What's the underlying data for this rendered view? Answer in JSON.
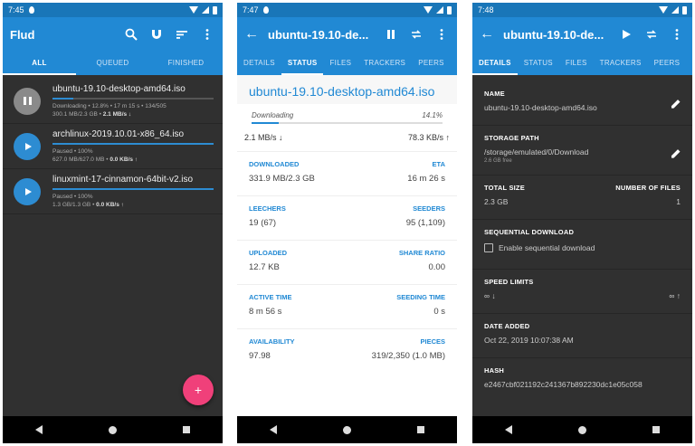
{
  "status_times": [
    "7:45",
    "7:47",
    "7:48"
  ],
  "panel1": {
    "title": "Flud",
    "tabs": [
      "ALL",
      "QUEUED",
      "FINISHED"
    ],
    "torrents": [
      {
        "name": "ubuntu-19.10-desktop-amd64.iso",
        "meta1": "Downloading • 12.8% • 17 m 15 s • 134/505",
        "meta2a": "300.1 MB/2.3 GB • ",
        "meta2b": "2.1 MB/s ↓",
        "progress": 0.128,
        "state": "pause"
      },
      {
        "name": "archlinux-2019.10.01-x86_64.iso",
        "meta1": "Paused • 100%",
        "meta2a": "627.0 MB/627.0 MB • ",
        "meta2b": "0.0 KB/s ↑",
        "progress": 1.0,
        "state": "play"
      },
      {
        "name": "linuxmint-17-cinnamon-64bit-v2.iso",
        "meta1": "Paused • 100%",
        "meta2a": "1.3 GB/1.3 GB • ",
        "meta2b": "0.0 KB/s ↑",
        "progress": 1.0,
        "state": "play"
      }
    ],
    "fab_label": "+"
  },
  "panel2": {
    "title": "ubuntu-19.10-de...",
    "tabs": [
      "DETAILS",
      "STATUS",
      "FILES",
      "TRACKERS",
      "PEERS"
    ],
    "torrent_name": "ubuntu-19.10-desktop-amd64.iso",
    "state": "Downloading",
    "percent": "14.1%",
    "progress": 0.141,
    "down_speed": "2.1 MB/s ↓",
    "up_speed": "78.3 KB/s ↑",
    "stats": [
      {
        "l1": "DOWNLOADED",
        "v1": "331.9 MB/2.3 GB",
        "l2": "ETA",
        "v2": "16 m 26 s"
      },
      {
        "l1": "LEECHERS",
        "v1": "19 (67)",
        "l2": "SEEDERS",
        "v2": "95 (1,109)"
      },
      {
        "l1": "UPLOADED",
        "v1": "12.7 KB",
        "l2": "SHARE RATIO",
        "v2": "0.00"
      },
      {
        "l1": "ACTIVE TIME",
        "v1": "8 m 56 s",
        "l2": "SEEDING TIME",
        "v2": "0 s"
      },
      {
        "l1": "AVAILABILITY",
        "v1": "97.98",
        "l2": "PIECES",
        "v2": "319/2,350 (1.0 MB)"
      }
    ]
  },
  "panel3": {
    "title": "ubuntu-19.10-de...",
    "tabs": [
      "DETAILS",
      "STATUS",
      "FILES",
      "TRACKERS",
      "PEERS"
    ],
    "name_label": "NAME",
    "name_value": "ubuntu-19.10-desktop-amd64.iso",
    "storage_label": "STORAGE PATH",
    "storage_value": "/storage/emulated/0/Download",
    "storage_free": "2.6 GB free",
    "size_label": "TOTAL SIZE",
    "size_value": "2.3 GB",
    "files_label": "NUMBER OF FILES",
    "files_value": "1",
    "seq_label": "SEQUENTIAL DOWNLOAD",
    "seq_option": "Enable sequential download",
    "limits_label": "SPEED LIMITS",
    "limit_down": "∞ ↓",
    "limit_up": "∞ ↑",
    "date_label": "DATE ADDED",
    "date_value": "Oct 22, 2019 10:07:38 AM",
    "hash_label": "HASH",
    "hash_value": "e2467cbf021192c241367b892230dc1e05c058"
  }
}
